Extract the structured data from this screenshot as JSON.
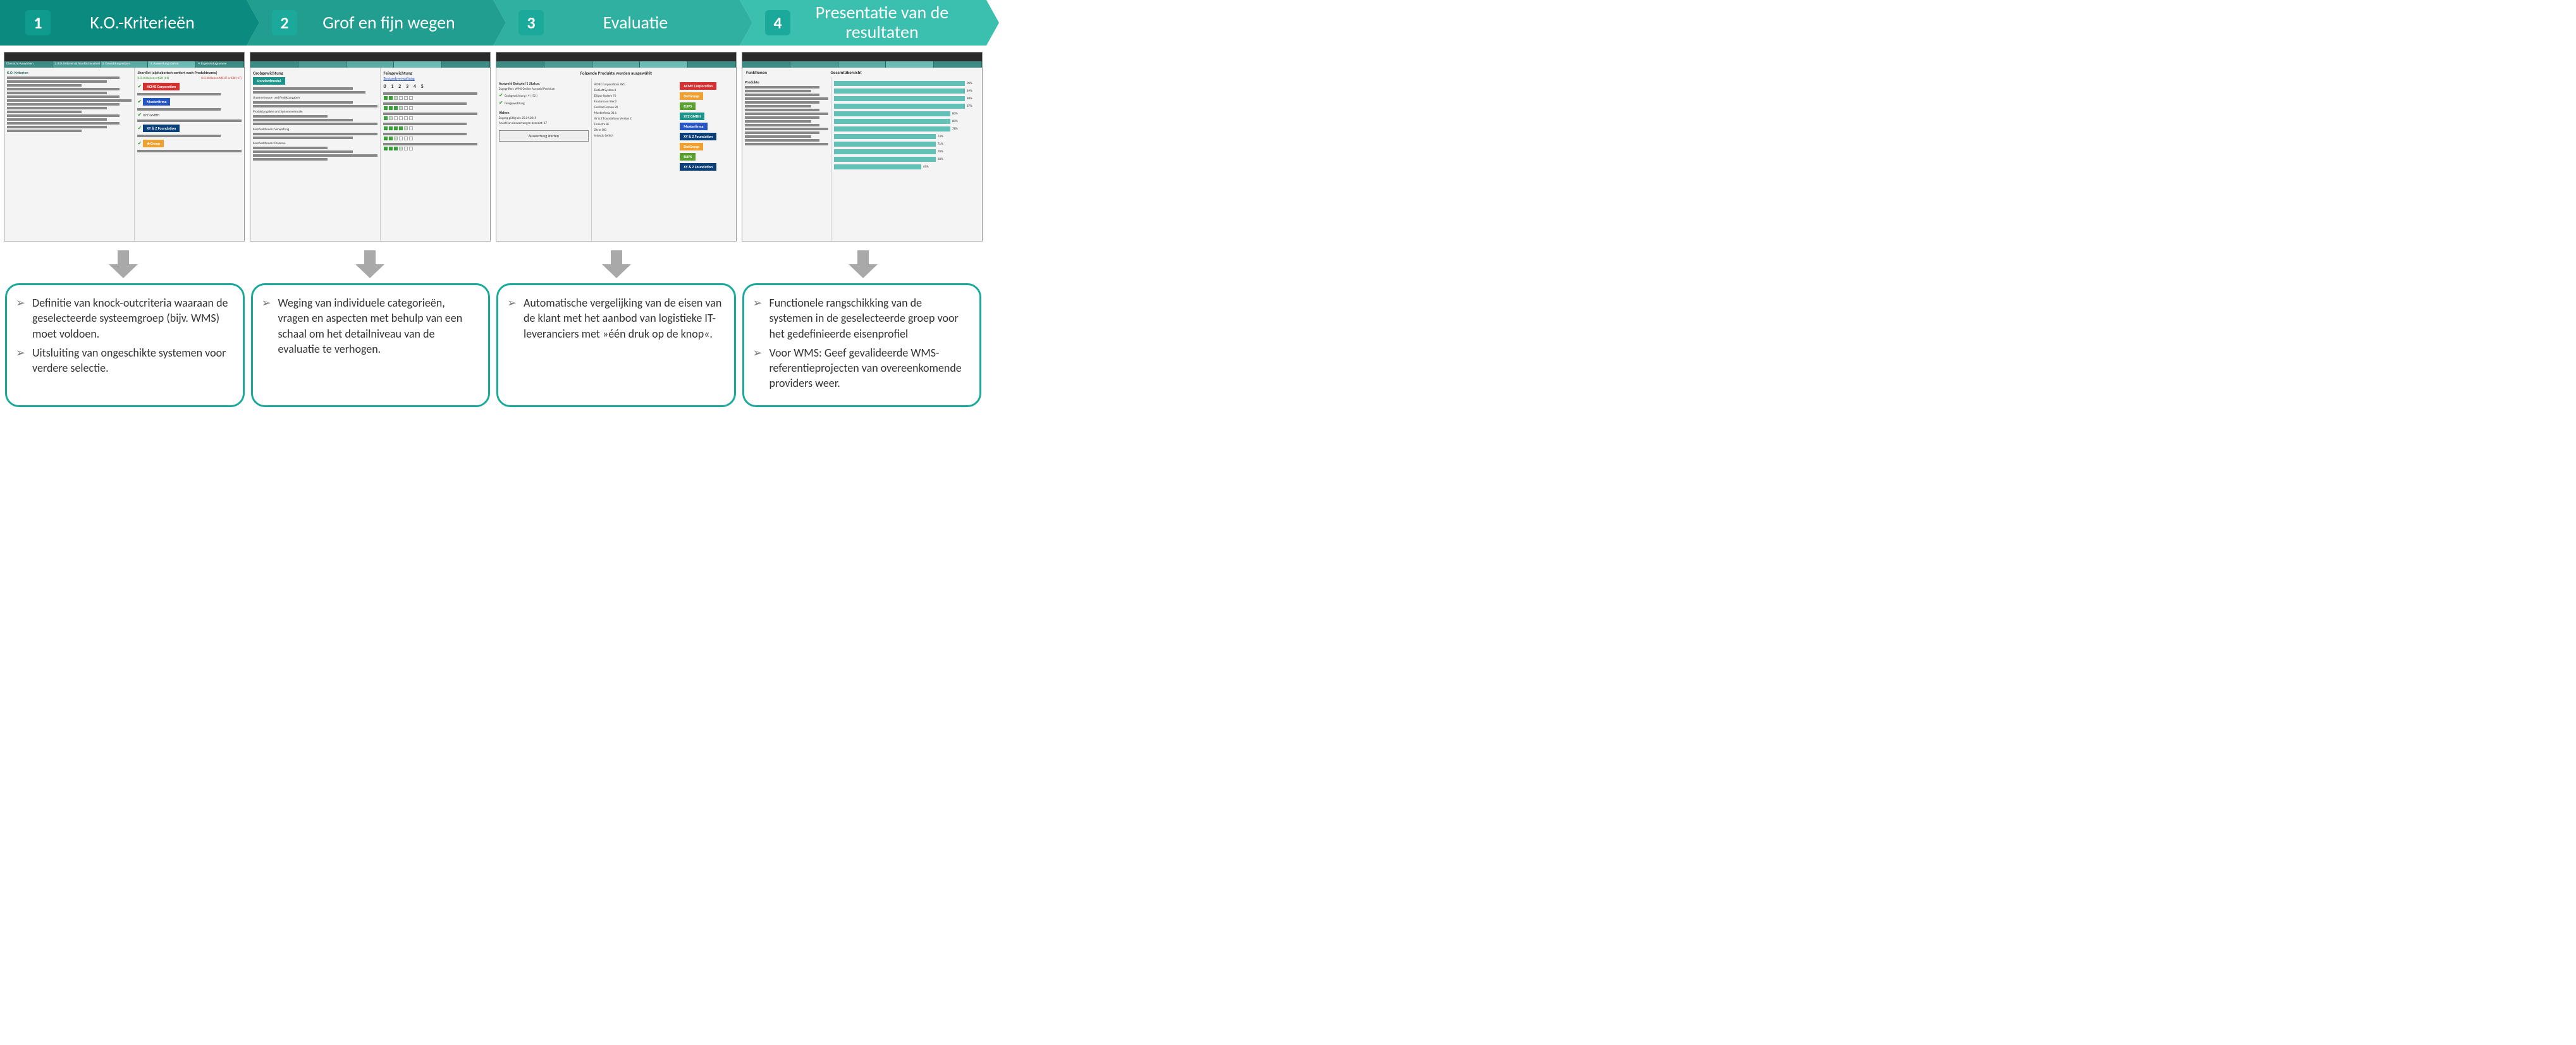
{
  "steps": [
    {
      "num": "1",
      "title": "K.O.-Kriterieën"
    },
    {
      "num": "2",
      "title": "Grof en fijn wegen"
    },
    {
      "num": "3",
      "title": "Evaluatie"
    },
    {
      "num": "4",
      "title": "Presentatie van de resultaten"
    }
  ],
  "screens": {
    "s1": {
      "tabLabels": [
        "Übersicht Auswählen",
        "1. K.O.-Kriterien & Shortlist bearbeiten",
        "2. Gewichtung setzen",
        "3. Auswertung starten",
        "4. Ergebnisdiagramme"
      ],
      "header": "Shortlist (alphabetisch sortiert nach Produktname)",
      "leftHeading": "K.O.-Kriterien",
      "fulfilled": "K.O.-Kriterien erfüllt (61)",
      "notFulfilled": "K.O.-Kriterien NICHT erfüllt (17)",
      "badges": [
        "ACME Corporation",
        "Musterfirma",
        "XY & Z Foundation"
      ]
    },
    "s2": {
      "leftTitle": "Grobgewichtung",
      "leftTag": "Standardmodul",
      "rightTitle": "Feingewichtung",
      "rightSub": "Bestandsverwaltung",
      "scale": "0 1 2 3 4 5"
    },
    "s3": {
      "banner": "Folgende Produkte wurden ausgewählt",
      "statusTitle": "Auswahl Beispiel 1 Status:",
      "line1": "Zugegriffen: WMS Online Auswahl Premium",
      "line2": "Grobgewichtung ( 4 | 52 )",
      "line3": "Feingewichtung",
      "action": "Aktion",
      "dates": "Zugang gültig bis: 25.04.2019",
      "count": "Anzahl an Auswertungen beendet: 17",
      "button": "Auswertung starten",
      "products": [
        "ACME Corporations 891",
        "DotSoft System 8",
        "Ellipse System 76",
        "Featurecon Vier.0",
        "Gorillaz Demon 20",
        "Musterfirma 30.1",
        "XY & Z Foundations Version 2",
        "Fenestre BE",
        "Zitrin 500",
        "Intendo Switch"
      ],
      "sideBadges": [
        "ACME Corporation",
        "DotGroup",
        "ELIPS",
        "XYZ GMBH",
        "Musterfirma",
        "XY & Z Foundation",
        "DotGroup",
        "ELIPS",
        "XY & Z Foundation"
      ]
    },
    "s4": {
      "leftCol": "Funktionen",
      "rightCol": "Gesamtübersicht",
      "leftHeading": "Produkte",
      "percentages": [
        "90%",
        "89%",
        "88%",
        "87%",
        "80%",
        "80%",
        "78%",
        "74%",
        "71%",
        "70%",
        "68%",
        "65%"
      ]
    }
  },
  "descriptions": [
    [
      "Definitie van knock-outcriteria waaraan de geselecteerde systeemgroep (bijv. WMS) moet voldoen.",
      "Uitsluiting van ongeschikte systemen voor verdere selectie."
    ],
    [
      "Weging van individuele categorieën, vragen en aspecten met behulp van een schaal om het detailniveau van de evaluatie te verhogen."
    ],
    [
      "Automatische vergelijking van de eisen van de klant met het aanbod van logistieke IT-leveranciers met »één druk op de knop«."
    ],
    [
      "Functionele rangschikking van de systemen in de geselecteerde groep voor het gedefinieerde eisenprofiel",
      "Voor WMS: Geef gevalideerde WMS-referentieprojecten van overeenkomende providers weer."
    ]
  ]
}
